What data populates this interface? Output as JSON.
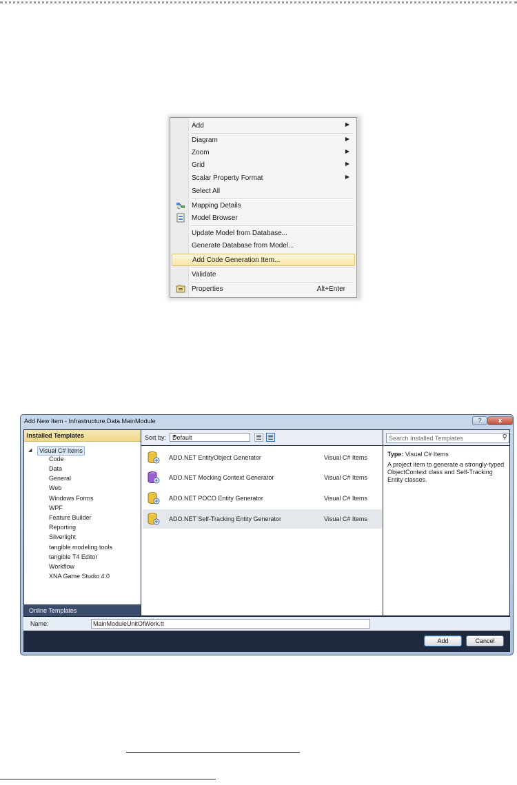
{
  "context_menu": {
    "items": [
      {
        "label": "Add",
        "submenu": true
      },
      {
        "label": "Diagram",
        "submenu": true
      },
      {
        "label": "Zoom",
        "submenu": true
      },
      {
        "label": "Grid",
        "submenu": true
      },
      {
        "label": "Scalar Property Format",
        "submenu": true
      },
      {
        "label": "Select All"
      },
      {
        "label": "Mapping Details",
        "icon": "mapping-details-icon"
      },
      {
        "label": "Model Browser",
        "icon": "model-browser-icon"
      },
      {
        "label": "Update Model from Database..."
      },
      {
        "label": "Generate Database from Model..."
      },
      {
        "label": "Add Code Generation Item...",
        "highlighted": true
      },
      {
        "label": "Validate"
      },
      {
        "label": "Properties",
        "icon": "properties-icon",
        "shortcut": "Alt+Enter"
      }
    ]
  },
  "dialog": {
    "title": "Add New Item - Infrastructure.Data.MainModule",
    "help_label": "?",
    "close_label": "x",
    "installed_templates": {
      "header": "Installed Templates",
      "root": "Visual C# Items",
      "children": [
        "Code",
        "Data",
        "General",
        "Web",
        "Windows Forms",
        "WPF",
        "Feature Builder",
        "Reporting",
        "Silverlight",
        "tangible modeling tools",
        "tangible T4 Editor",
        "Workflow",
        "XNA Game Studio 4.0"
      ],
      "online": "Online Templates"
    },
    "sort": {
      "label": "Sort by:",
      "value": "Default"
    },
    "search_placeholder": "Search Installed Templates",
    "templates": [
      {
        "name": "ADO.NET EntityObject Generator",
        "category": "Visual C# Items",
        "icon": "template-yellow-icon"
      },
      {
        "name": "ADO.NET Mocking Context Generator",
        "category": "Visual C# Items",
        "icon": "template-purple-icon"
      },
      {
        "name": "ADO.NET POCO Entity Generator",
        "category": "Visual C# Items",
        "icon": "template-yellow-icon"
      },
      {
        "name": "ADO.NET Self-Tracking Entity Generator",
        "category": "Visual C# Items",
        "icon": "template-yellow-icon",
        "selected": true
      }
    ],
    "details": {
      "type_label": "Type:",
      "type_value": "Visual C# Items",
      "description": "A project item to generate a strongly-typed ObjectContext class and Self-Tracking Entity classes."
    },
    "name_label": "Name:",
    "name_value": "MainModuleUnitOfWork.tt",
    "add_label": "Add",
    "cancel_label": "Cancel"
  }
}
